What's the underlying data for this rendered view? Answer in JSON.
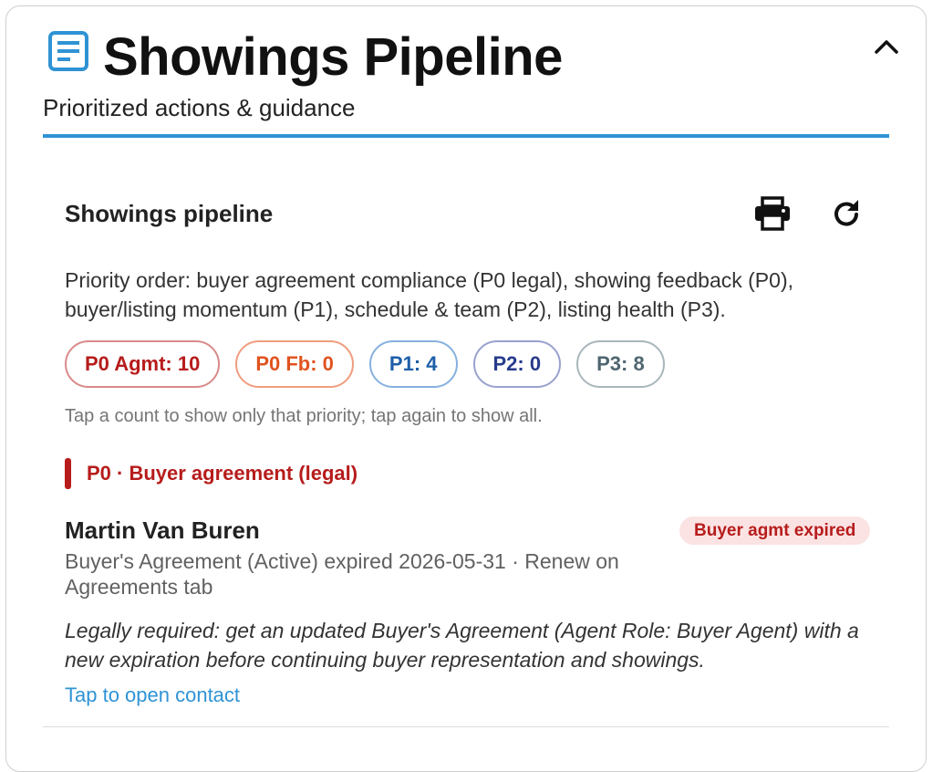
{
  "header": {
    "title": "Showings Pipeline",
    "subtitle": "Prioritized actions & guidance",
    "icon": "clipboard-list-icon",
    "collapse_icon": "chevron-up-icon",
    "accent_color": "#2f93d5"
  },
  "section": {
    "title": "Showings pipeline",
    "print_icon": "print-icon",
    "refresh_icon": "refresh-icon",
    "priority_text": "Priority order: buyer agreement compliance (P0 legal), showing feedback (P0), buyer/listing momentum (P1), schedule & team (P2), listing health (P3).",
    "chips": [
      {
        "label": "P0 Agmt: 10",
        "color": "#b71c1c",
        "border": "#d98a8a"
      },
      {
        "label": "P0 Fb: 0",
        "color": "#e0531f",
        "border": "#ef9d7f"
      },
      {
        "label": "P1: 4",
        "color": "#1e5fa8",
        "border": "#86b1df"
      },
      {
        "label": "P2: 0",
        "color": "#283c8c",
        "border": "#9aa1cf"
      },
      {
        "label": "P3: 8",
        "color": "#4e6670",
        "border": "#a9b6bb"
      }
    ],
    "hint": "Tap a count to show only that priority; tap again to show all."
  },
  "group": {
    "label": "P0 · Buyer agreement (legal)",
    "color": "#b71c1c"
  },
  "items": [
    {
      "name": "Martin Van Buren",
      "badge": "Buyer agmt expired",
      "detail": "Buyer's Agreement (Active) expired 2026-05-31 · Renew on Agreements tab",
      "note": "Legally required: get an updated Buyer's Agreement (Agent Role: Buyer Agent) with a new expiration before continuing buyer representation and showings.",
      "link": "Tap to open contact"
    }
  ]
}
